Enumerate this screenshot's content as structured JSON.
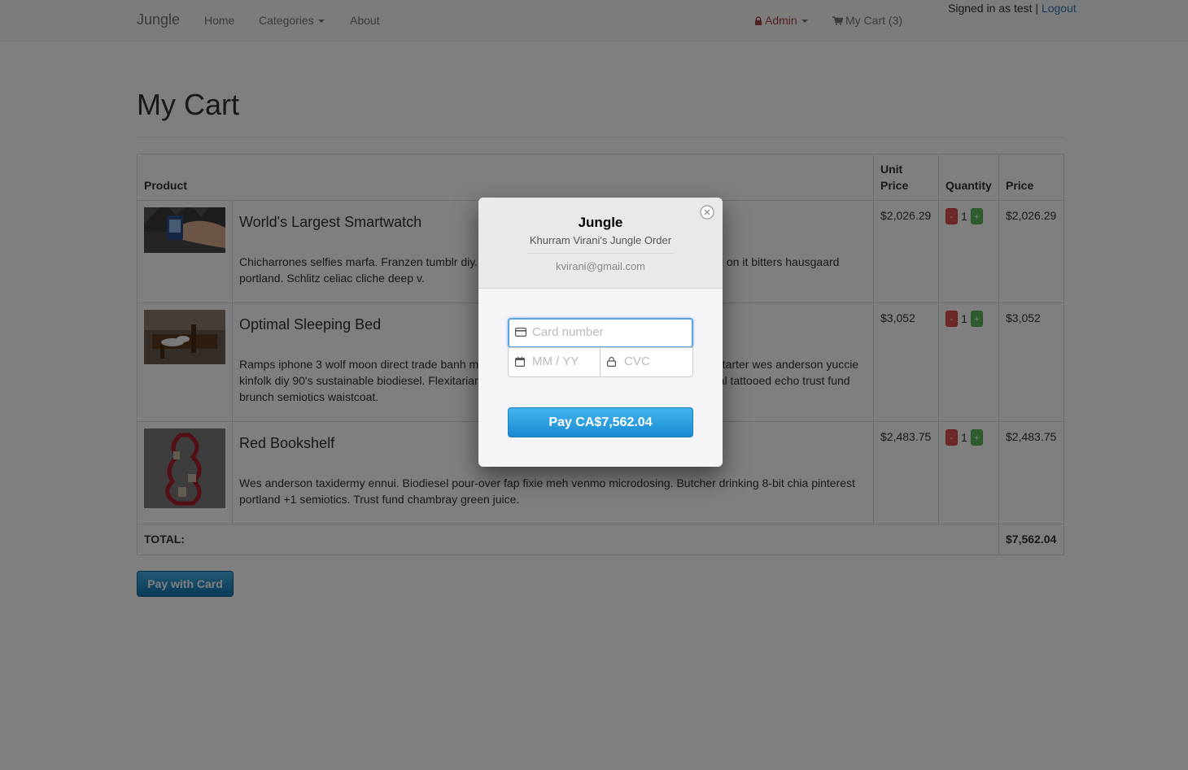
{
  "navbar": {
    "brand": "Jungle",
    "home": "Home",
    "categories": "Categories",
    "about": "About",
    "admin": "Admin",
    "cart": "My Cart (3)",
    "signed_in": "Signed in as test |",
    "logout": "Logout"
  },
  "page": {
    "title": "My Cart"
  },
  "table": {
    "headers": {
      "product": "Product",
      "unit_price": "Unit Price",
      "quantity": "Quantity",
      "price": "Price"
    },
    "rows": [
      {
        "name": "World's Largest Smartwatch",
        "description": "Chicharrones selfies marfa. Franzen tumblr diy. Kombucha mustache trust fund listicle put a bird on it bitters hausgaard portland. Schlitz celiac cliche deep v.",
        "unit_price": "$2,026.29",
        "qty": "1",
        "price": "$2,026.29",
        "minus": "-",
        "plus": "+"
      },
      {
        "name": "Optimal Sleeping Bed",
        "description": "Ramps iphone 3 wolf moon direct trade banh mi hoodie humblebrag plaid godard brooklyn kickstarter wes anderson yuccie kinfolk diy 90's sustainable biodiesel. Flexitarian vhs fingerstache polaroid leggings lumbersexual tattooed echo trust fund brunch semiotics waistcoat.",
        "unit_price": "$3,052",
        "qty": "1",
        "price": "$3,052",
        "minus": "-",
        "plus": "+"
      },
      {
        "name": "Red Bookshelf",
        "description": "Wes anderson taxidermy ennui. Biodiesel pour-over fap fixie meh venmo microdosing. Butcher drinking 8-bit chia pinterest portland +1 semiotics. Trust fund chambray green juice.",
        "unit_price": "$2,483.75",
        "qty": "1",
        "price": "$2,483.75",
        "minus": "-",
        "plus": "+"
      }
    ],
    "total_label": "TOTAL:",
    "total_value": "$7,562.04"
  },
  "pay_with_card": "Pay with Card",
  "modal": {
    "title": "Jungle",
    "subtitle": "Khurram Virani's Jungle Order",
    "email": "kvirani@gmail.com",
    "card_placeholder": "Card number",
    "expiry_placeholder": "MM / YY",
    "cvc_placeholder": "CVC",
    "pay_button": "Pay CA$7,562.04"
  },
  "colors": {
    "link": "#337ab7",
    "admin": "#a94442",
    "pay_button": "#1a8bd2",
    "minus": "#d9534f",
    "plus": "#5cb85c"
  }
}
